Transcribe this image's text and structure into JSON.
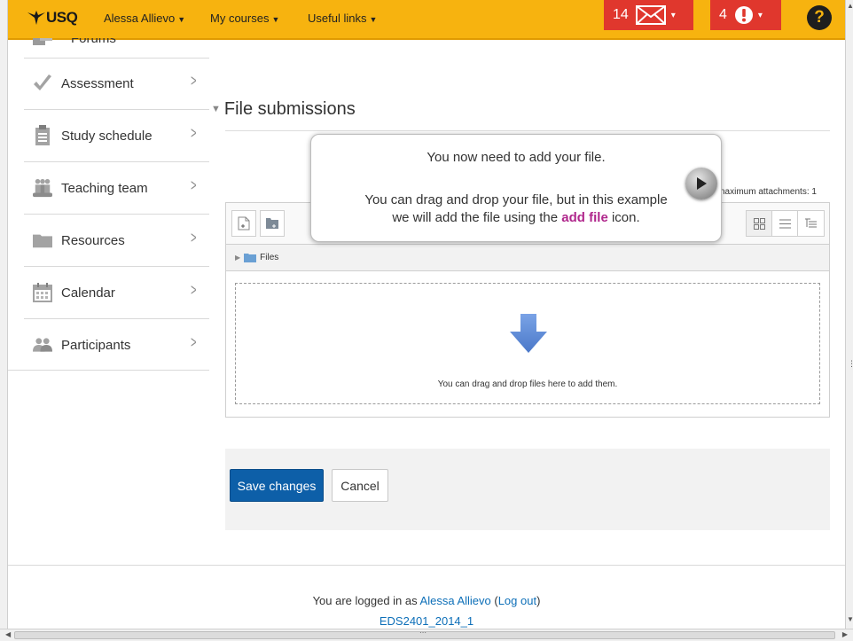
{
  "nav": {
    "logo": "USQ",
    "user": "Alessa Allievo",
    "my_courses": "My courses",
    "useful_links": "Useful links",
    "messages_count": "14",
    "alerts_count": "4",
    "help": "?",
    "colors": {
      "bar": "#f7b30f",
      "badge": "#e0372d"
    }
  },
  "sidebar": {
    "partial_top": "Forums",
    "items": [
      {
        "label": "Assessment",
        "icon": "checkmark-icon"
      },
      {
        "label": "Study schedule",
        "icon": "clipboard-icon"
      },
      {
        "label": "Teaching team",
        "icon": "team-icon"
      },
      {
        "label": "Resources",
        "icon": "folder-icon"
      },
      {
        "label": "Calendar",
        "icon": "calendar-icon"
      },
      {
        "label": "Participants",
        "icon": "people-icon"
      }
    ]
  },
  "section": {
    "title": "File submissions"
  },
  "filepicker": {
    "max_attachments": "naximum attachments: 1",
    "path_folder": "Files",
    "drop_text": "You can drag and drop files here to add them."
  },
  "tour": {
    "line1": "You now need to add your file.",
    "line2": "You can drag and drop your file, but in this example",
    "line3_pre": "we will add the file using the ",
    "line3_hl": "add file",
    "line3_post": " icon.",
    "highlight_color": "#b0278c"
  },
  "actions": {
    "save": "Save changes",
    "cancel": "Cancel"
  },
  "footer": {
    "logged_in_pre": "You are logged in as ",
    "user": "Alessa Allievo",
    "logout_open": " (",
    "logout": "Log out",
    "logout_close": ")",
    "course": "EDS2401_2014_1"
  }
}
